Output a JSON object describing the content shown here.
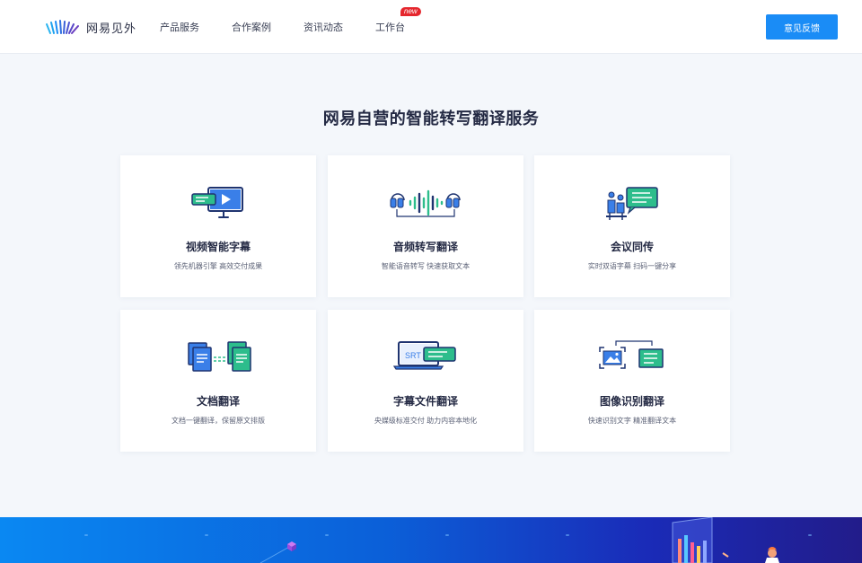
{
  "header": {
    "logo_text": "网易见外",
    "nav": [
      {
        "label": "产品服务"
      },
      {
        "label": "合作案例"
      },
      {
        "label": "资讯动态"
      },
      {
        "label": "工作台",
        "badge": "new"
      }
    ],
    "feedback_label": "意见反馈"
  },
  "section": {
    "title": "网易自营的智能转写翻译服务",
    "cards": [
      {
        "title": "视频智能字幕",
        "desc": "领先机器引擎 高效交付成果",
        "icon": "video-subtitle-icon"
      },
      {
        "title": "音频转写翻译",
        "desc": "智能语音转写 快速获取文本",
        "icon": "audio-transcribe-icon"
      },
      {
        "title": "会议同传",
        "desc": "实时双语字幕 扫码一键分享",
        "icon": "meeting-interpret-icon"
      },
      {
        "title": "文档翻译",
        "desc": "文档一键翻译，保留原文排版",
        "icon": "document-translate-icon"
      },
      {
        "title": "字幕文件翻译",
        "desc": "央媒级标准交付 助力内容本地化",
        "icon": "subtitle-file-icon"
      },
      {
        "title": "图像识别翻译",
        "desc": "快速识别文字 精准翻译文本",
        "icon": "image-recognition-icon"
      }
    ],
    "srt_label": "SRT"
  },
  "colors": {
    "accent": "#1a8cf6",
    "icon_blue": "#2f6fe0",
    "icon_green": "#2dbd8c",
    "icon_navy": "#1f3470"
  }
}
